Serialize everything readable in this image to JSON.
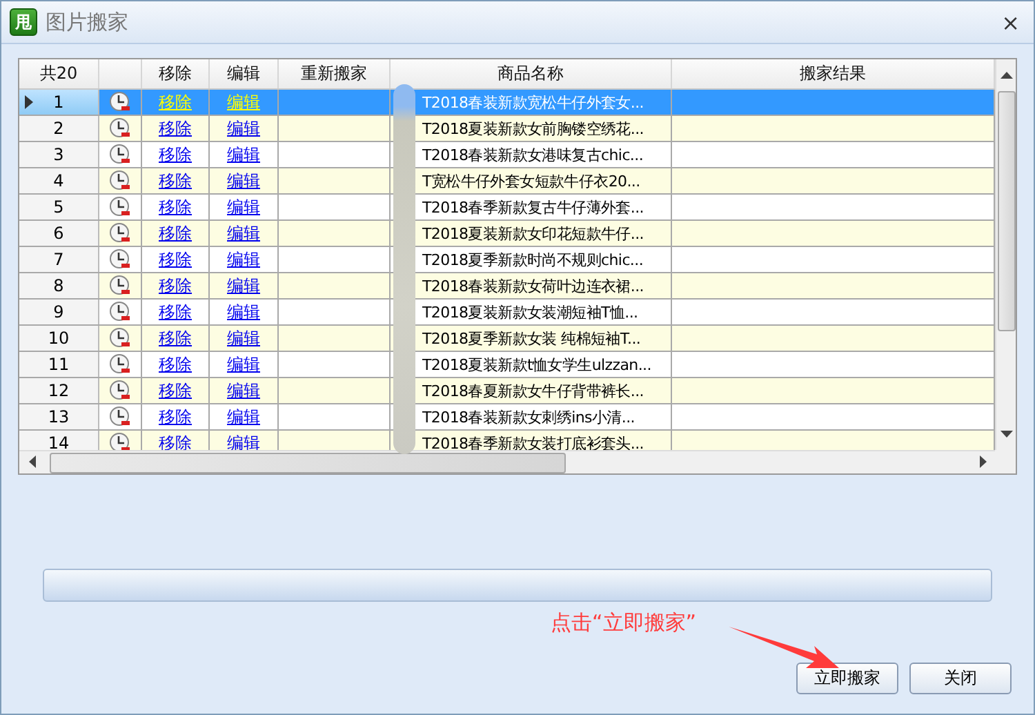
{
  "window": {
    "app_icon": "甩",
    "title": "图片搬家",
    "close": "×"
  },
  "table": {
    "count_header": "共20",
    "columns": [
      "移除",
      "编辑",
      "重新搬家",
      "商品名称",
      "搬家结果"
    ],
    "rows": [
      {
        "number": "1",
        "remove": "移除",
        "edit": "编辑",
        "name": "T2018春装新款宽松牛仔外套女...",
        "selected": true
      },
      {
        "number": "2",
        "remove": "移除",
        "edit": "编辑",
        "name": "T2018夏装新款女前胸镂空绣花...",
        "selected": false
      },
      {
        "number": "3",
        "remove": "移除",
        "edit": "编辑",
        "name": "T2018春装新款女港味复古chic...",
        "selected": false
      },
      {
        "number": "4",
        "remove": "移除",
        "edit": "编辑",
        "name": "T宽松牛仔外套女短款牛仔衣20...",
        "selected": false
      },
      {
        "number": "5",
        "remove": "移除",
        "edit": "编辑",
        "name": "T2018春季新款复古牛仔薄外套...",
        "selected": false
      },
      {
        "number": "6",
        "remove": "移除",
        "edit": "编辑",
        "name": "T2018夏装新款女印花短款牛仔...",
        "selected": false
      },
      {
        "number": "7",
        "remove": "移除",
        "edit": "编辑",
        "name": "T2018夏季新款时尚不规则chic...",
        "selected": false
      },
      {
        "number": "8",
        "remove": "移除",
        "edit": "编辑",
        "name": "T2018春装新款女荷叶边连衣裙...",
        "selected": false
      },
      {
        "number": "9",
        "remove": "移除",
        "edit": "编辑",
        "name": "T2018夏装新款女装潮短袖T恤...",
        "selected": false
      },
      {
        "number": "10",
        "remove": "移除",
        "edit": "编辑",
        "name": "T2018夏季新款女装 纯棉短袖T...",
        "selected": false
      },
      {
        "number": "11",
        "remove": "移除",
        "edit": "编辑",
        "name": "T2018夏装新款t恤女学生ulzzan...",
        "selected": false
      },
      {
        "number": "12",
        "remove": "移除",
        "edit": "编辑",
        "name": "T2018春夏新款女牛仔背带裤长...",
        "selected": false
      },
      {
        "number": "13",
        "remove": "移除",
        "edit": "编辑",
        "name": "T2018春装新款女刺绣ins小清...",
        "selected": false
      },
      {
        "number": "14",
        "remove": "移除",
        "edit": "编辑",
        "name": "T2018春季新款女装打底衫套头...",
        "selected": false
      }
    ]
  },
  "progress": {
    "level": 0
  },
  "annotation": "点击“立即搬家”",
  "buttons": [
    "立即搬家",
    "关闭"
  ]
}
